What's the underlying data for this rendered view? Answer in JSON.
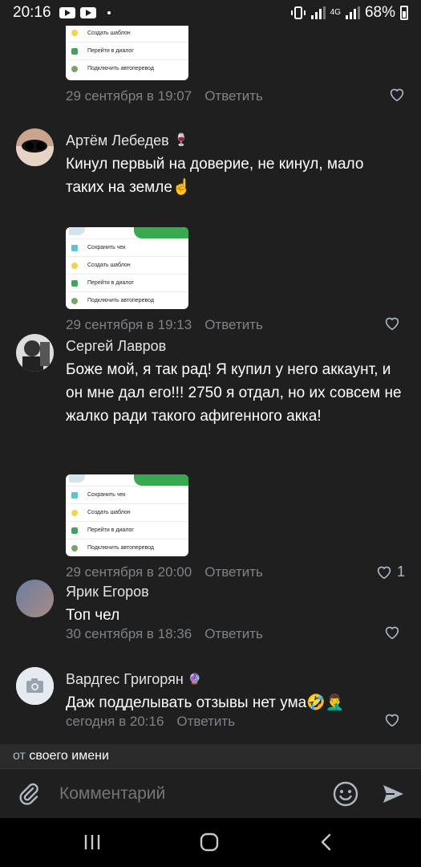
{
  "status_bar": {
    "time": "20:16",
    "network": "4G",
    "battery": "68%"
  },
  "first_partial": {
    "thumb_rows": [
      "Создать шаблон",
      "Перейти в диалог",
      "Подключить автоперевод"
    ],
    "date": "29 сентября в 19:07",
    "reply_label": "Ответить"
  },
  "comments": [
    {
      "author": "Артём Лебедев",
      "author_emoji": "🍷",
      "text": "Кинул первый на доверие, не кинул, мало таких на земле☝️",
      "thumb_rows": [
        "Сохранить чек",
        "Создать шаблон",
        "Перейти в диалог",
        "Подключить автоперевод"
      ],
      "date": "29 сентября в 19:13",
      "reply_label": "Ответить",
      "likes": ""
    },
    {
      "author": "Сергей Лавров",
      "author_emoji": "",
      "text": "Боже мой, я так рад! Я купил у него аккаунт, и он мне дал его!!! 2750 я отдал, но их совсем не жалко ради такого афигенного акка!",
      "thumb_rows": [
        "Сохранить чек",
        "Создать шаблон",
        "Перейти в диалог",
        "Подключить автоперевод"
      ],
      "date": "29 сентября в 20:00",
      "reply_label": "Ответить",
      "likes": "1"
    },
    {
      "author": "Ярик Егоров",
      "author_emoji": "",
      "text": "Топ чел",
      "date": "30 сентября в 18:36",
      "reply_label": "Ответить",
      "likes": ""
    },
    {
      "author": "Вардгес Григорян",
      "author_emoji": "🔮",
      "text": "Даж подделывать отзывы нет ума🤣🤦‍♂️",
      "date": "сегодня в 20:16",
      "reply_label": "Ответить",
      "likes": ""
    }
  ],
  "from_bar": {
    "prefix": "от",
    "value": "своего имени"
  },
  "compose": {
    "placeholder": "Комментарий"
  },
  "colors": {
    "background": "#1f1f1f",
    "muted_text": "#7e8389",
    "thumb_green": "#38a851"
  }
}
